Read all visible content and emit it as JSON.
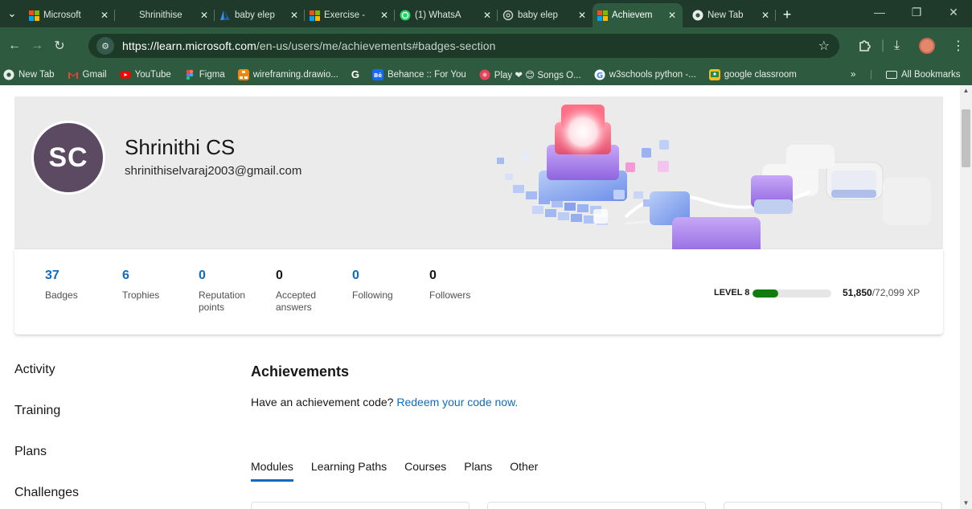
{
  "browser": {
    "tabs": [
      {
        "title": "Microsoft",
        "favicon": "microsoft-logo"
      },
      {
        "title": "Shrinithise",
        "favicon": "none"
      },
      {
        "title": "baby elep",
        "favicon": "azure-logo"
      },
      {
        "title": "Exercise -",
        "favicon": "microsoft-logo"
      },
      {
        "title": "(1) WhatsA",
        "favicon": "whatsapp-icon"
      },
      {
        "title": "baby elep",
        "favicon": "openai-icon"
      },
      {
        "title": "Achievem",
        "favicon": "microsoft-logo",
        "active": true
      },
      {
        "title": "New Tab",
        "favicon": "chrome-icon"
      }
    ],
    "url_host": "https://learn.microsoft.com",
    "url_path": "/en-us/users/me/achievements#badges-section",
    "bookmarks": [
      {
        "label": "New Tab",
        "icon": "chrome-icon"
      },
      {
        "label": "Gmail",
        "icon": "gmail-icon"
      },
      {
        "label": "YouTube",
        "icon": "youtube-icon"
      },
      {
        "label": "Figma",
        "icon": "figma-icon"
      },
      {
        "label": "wireframing.drawio...",
        "icon": "drawio-icon"
      },
      {
        "label": "",
        "icon": "google-g-icon"
      },
      {
        "label": "Behance :: For You",
        "icon": "behance-icon"
      },
      {
        "label": "Play ❤ 😊 Songs O...",
        "icon": "music-icon"
      },
      {
        "label": "w3schools python -...",
        "icon": "google-icon"
      },
      {
        "label": "google classroom",
        "icon": "classroom-icon"
      }
    ],
    "overflow_label": "»",
    "all_bookmarks": "All Bookmarks"
  },
  "profile": {
    "initials": "SC",
    "name": "Shrinithi CS",
    "email": "shrinithiselvaraj2003@gmail.com"
  },
  "stats": [
    {
      "value": "37",
      "label": "Badges"
    },
    {
      "value": "6",
      "label": "Trophies"
    },
    {
      "value": "0",
      "label": "Reputation points"
    },
    {
      "value": "0",
      "label": "Accepted answers"
    },
    {
      "value": "0",
      "label": "Following"
    },
    {
      "value": "0",
      "label": "Followers"
    }
  ],
  "level": {
    "label": "LEVEL 8",
    "xp_current": "51,850",
    "xp_total": "/72,099 XP",
    "progress_fraction": 0.33
  },
  "sidenav": [
    "Activity",
    "Training",
    "Plans",
    "Challenges"
  ],
  "achievements": {
    "title": "Achievements",
    "redeem_prompt": "Have an achievement code?",
    "redeem_link": "Redeem your code now.",
    "tabs": [
      "Modules",
      "Learning Paths",
      "Courses",
      "Plans",
      "Other"
    ]
  },
  "colors": {
    "accent": "#0f6cbd",
    "xp_green": "#107c10",
    "avatar_bg": "#5b4a62",
    "chrome_frame": "#2e5a40"
  }
}
